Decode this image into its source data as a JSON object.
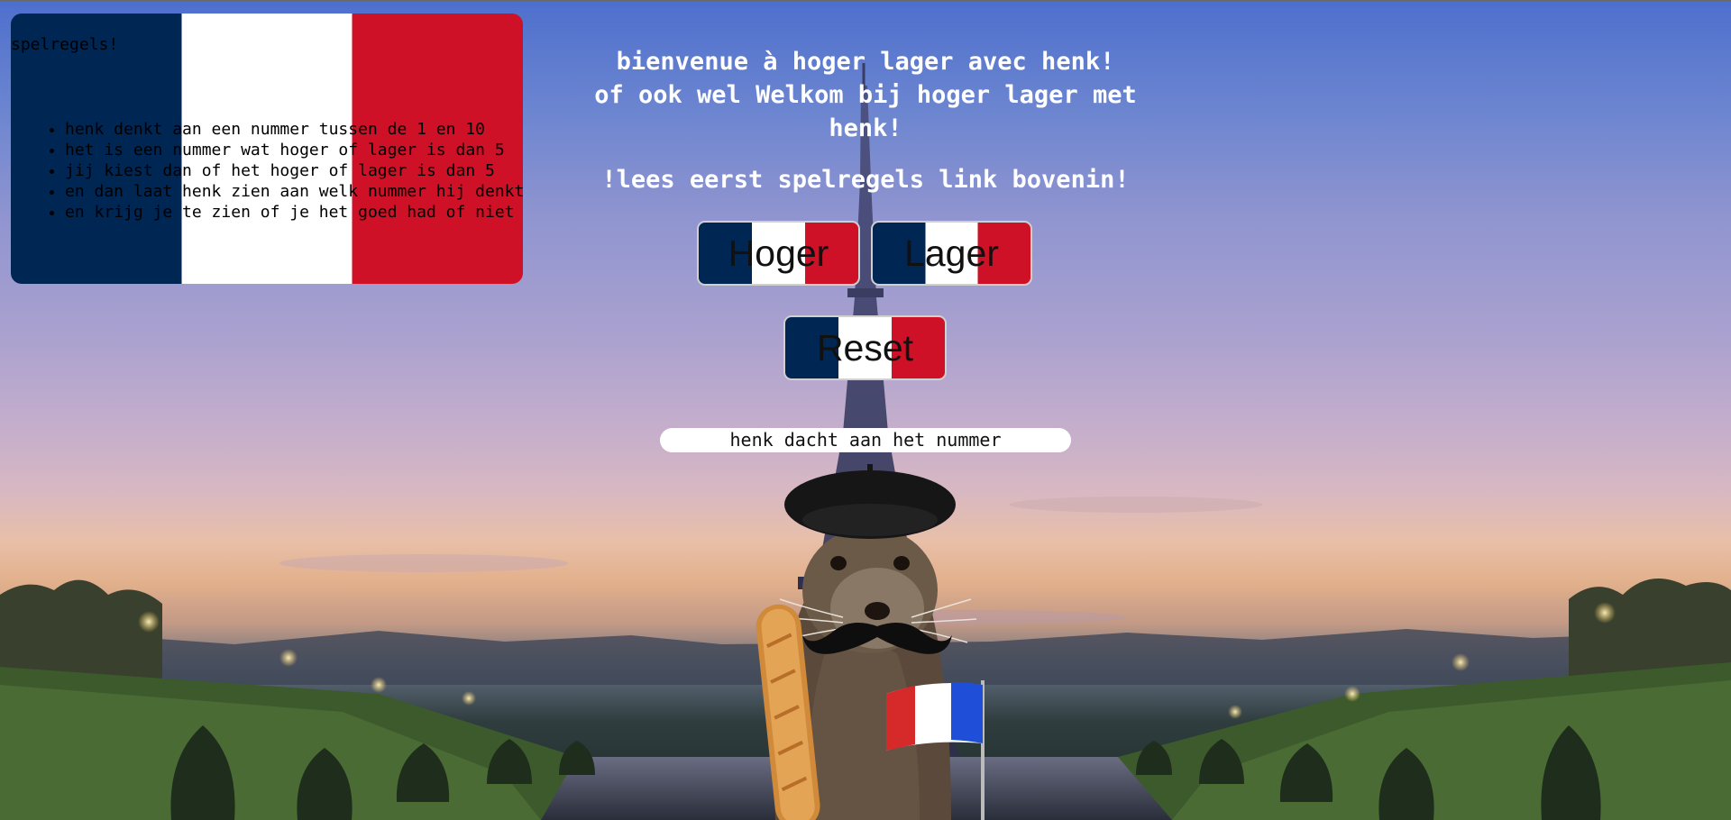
{
  "rules": {
    "title": "spelregels!",
    "items": [
      "henk denkt aan een nummer tussen de 1 en 10",
      "het is een nummer wat hoger of lager is dan 5",
      "jij kiest dan of het hoger of lager is dan 5",
      "en dan laat henk zien aan welk nummer hij denkt",
      "en krijg je te zien of je het goed had of niet"
    ]
  },
  "heading": {
    "line1": "bienvenue à hoger lager avec henk!",
    "line2": "of ook wel Welkom bij hoger lager met henk!"
  },
  "subheading": "!lees eerst spelregels link bovenin!",
  "buttons": {
    "hoger": "Hoger",
    "lager": "Lager",
    "reset": "Reset"
  },
  "result_text": "henk dacht aan het nummer",
  "icons": {
    "background": "eiffel-tower-scene",
    "mascot": "seal-with-beret-mustache-baguette-flag"
  },
  "colors": {
    "flag_blue": "#002654",
    "flag_white": "#ffffff",
    "flag_red": "#ce1126"
  }
}
